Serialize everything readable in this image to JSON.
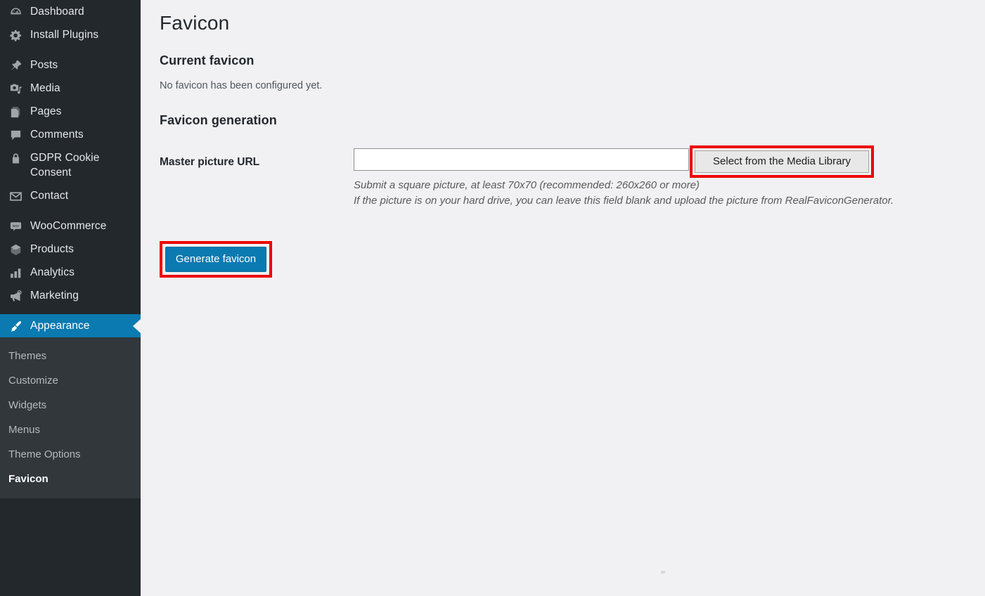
{
  "sidebar": {
    "items": [
      {
        "label": "Dashboard",
        "icon": "dashboard-icon",
        "active": false,
        "spacer_after": false
      },
      {
        "label": "Install Plugins",
        "icon": "gear-icon",
        "active": false,
        "spacer_after": true
      },
      {
        "label": "Posts",
        "icon": "pin-icon",
        "active": false,
        "spacer_after": false
      },
      {
        "label": "Media",
        "icon": "media-icon",
        "active": false,
        "spacer_after": false
      },
      {
        "label": "Pages",
        "icon": "pages-icon",
        "active": false,
        "spacer_after": false
      },
      {
        "label": "Comments",
        "icon": "comment-icon",
        "active": false,
        "spacer_after": false
      },
      {
        "label": "GDPR Cookie Consent",
        "icon": "lock-icon",
        "active": false,
        "spacer_after": false,
        "two_line": true
      },
      {
        "label": "Contact",
        "icon": "envelope-icon",
        "active": false,
        "spacer_after": true
      },
      {
        "label": "WooCommerce",
        "icon": "woocommerce-icon",
        "active": false,
        "spacer_after": false
      },
      {
        "label": "Products",
        "icon": "box-icon",
        "active": false,
        "spacer_after": false
      },
      {
        "label": "Analytics",
        "icon": "bar-chart-icon",
        "active": false,
        "spacer_after": false
      },
      {
        "label": "Marketing",
        "icon": "megaphone-icon",
        "active": false,
        "spacer_after": true
      },
      {
        "label": "Appearance",
        "icon": "paintbrush-icon",
        "active": true,
        "spacer_after": false
      }
    ],
    "submenu": [
      {
        "label": "Themes",
        "current": false
      },
      {
        "label": "Customize",
        "current": false
      },
      {
        "label": "Widgets",
        "current": false
      },
      {
        "label": "Menus",
        "current": false
      },
      {
        "label": "Theme Options",
        "current": false
      },
      {
        "label": "Favicon",
        "current": true
      }
    ]
  },
  "main": {
    "page_title": "Favicon",
    "current_favicon_heading": "Current favicon",
    "no_favicon_text": "No favicon has been configured yet.",
    "favicon_generation_heading": "Favicon generation",
    "field_label": "Master picture URL",
    "master_url_value": "",
    "master_url_placeholder": "",
    "media_library_button": "Select from the Media Library",
    "help_line_1": "Submit a square picture, at least 70x70 (recommended: 260x260 or more)",
    "help_line_2": "If the picture is on your hard drive, you can leave this field blank and upload the picture from RealFaviconGenerator.",
    "generate_button": "Generate favicon"
  },
  "colors": {
    "sidebar_bg": "#23282d",
    "submenu_bg": "#32373c",
    "active_blue": "#0b7ab0",
    "content_bg": "#f1f1f3",
    "annotation_red": "#ee0000",
    "text_dark": "#23282d"
  }
}
